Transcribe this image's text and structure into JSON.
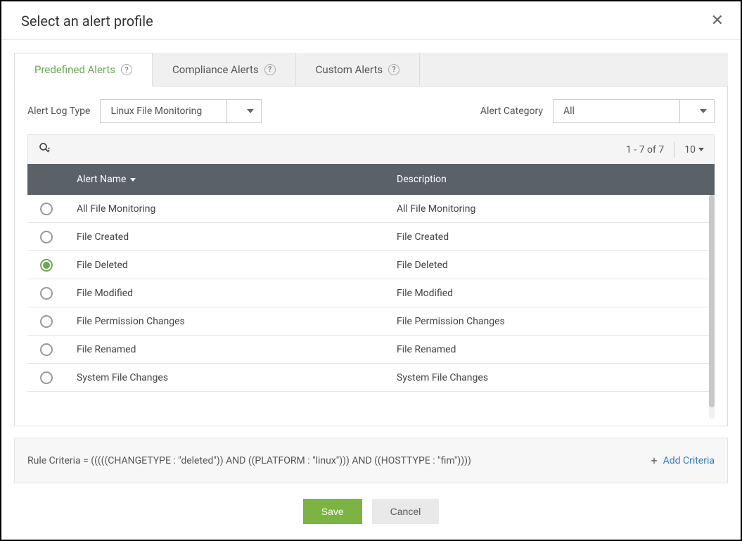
{
  "title": "Select an alert profile",
  "tabs": [
    {
      "label": "Predefined Alerts",
      "active": true
    },
    {
      "label": "Compliance Alerts",
      "active": false
    },
    {
      "label": "Custom Alerts",
      "active": false
    }
  ],
  "filters": {
    "log_type_label": "Alert Log Type",
    "log_type_value": "Linux File Monitoring",
    "category_label": "Alert Category",
    "category_value": "All"
  },
  "table": {
    "pagination": "1 - 7 of 7",
    "page_size": "10",
    "columns": {
      "name": "Alert Name",
      "description": "Description"
    },
    "rows": [
      {
        "name": "All File Monitoring",
        "description": "All File Monitoring",
        "selected": false
      },
      {
        "name": "File Created",
        "description": "File Created",
        "selected": false
      },
      {
        "name": "File Deleted",
        "description": "File Deleted",
        "selected": true
      },
      {
        "name": "File Modified",
        "description": "File Modified",
        "selected": false
      },
      {
        "name": "File Permission Changes",
        "description": "File Permission Changes",
        "selected": false
      },
      {
        "name": "File Renamed",
        "description": "File Renamed",
        "selected": false
      },
      {
        "name": "System File Changes",
        "description": "System File Changes",
        "selected": false
      }
    ]
  },
  "criteria": {
    "text": "Rule Criteria = (((((CHANGETYPE : \"deleted\")) AND ((PLATFORM : \"linux\"))) AND ((HOSTTYPE : \"fim\"))))",
    "add_label": "Add Criteria"
  },
  "buttons": {
    "save": "Save",
    "cancel": "Cancel"
  }
}
